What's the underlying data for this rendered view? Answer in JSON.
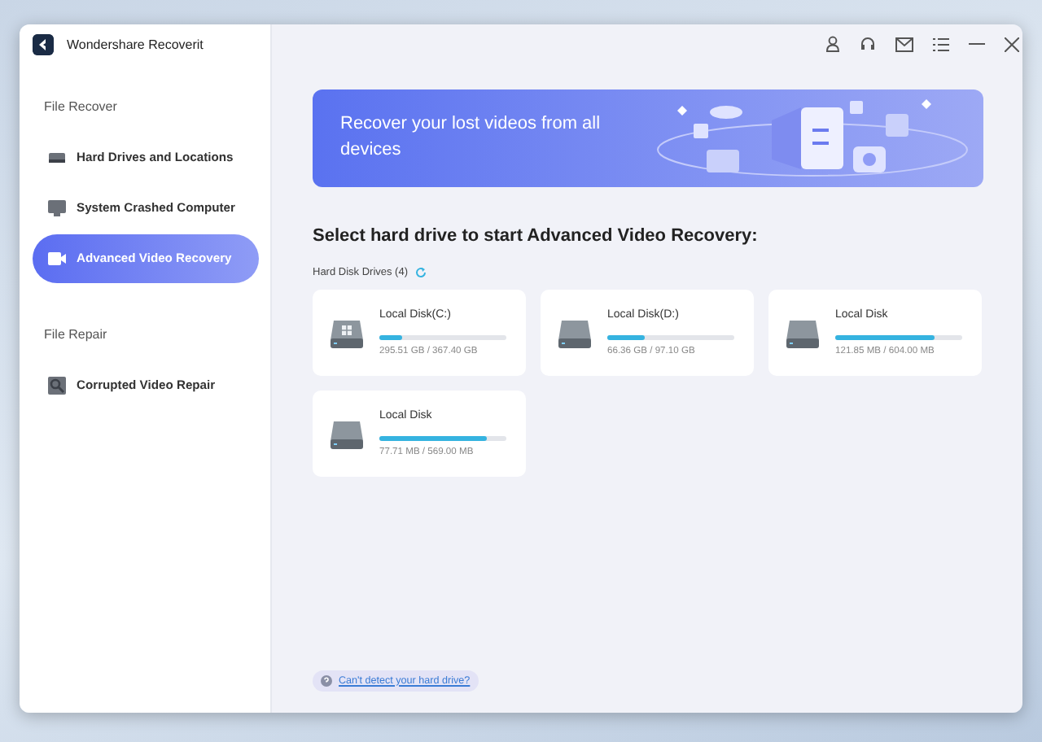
{
  "window": {
    "title": "Wondershare Recoverit"
  },
  "sidebar": {
    "sections": [
      {
        "heading": "File Recover",
        "items": [
          {
            "label": "Hard Drives and Locations",
            "kind": "drive",
            "selected": false
          },
          {
            "label": "System Crashed Computer",
            "kind": "monitor",
            "selected": false
          },
          {
            "label": "Advanced Video Recovery",
            "kind": "video",
            "selected": true
          }
        ]
      },
      {
        "heading": "File Repair",
        "items": [
          {
            "label": "Corrupted Video Repair",
            "kind": "repair",
            "selected": false
          }
        ]
      }
    ]
  },
  "banner": {
    "text": "Recover your lost videos from all devices"
  },
  "main": {
    "heading": "Select hard drive to start Advanced Video Recovery:",
    "subheading": "Hard Disk Drives (4)"
  },
  "drives": [
    {
      "name": "Local Disk(C:)",
      "kind": "system",
      "level": 0.18,
      "usage": "295.51 GB / 367.40 GB"
    },
    {
      "name": "Local Disk(D:)",
      "kind": "plain",
      "level": 0.3,
      "usage": "66.36 GB / 97.10 GB"
    },
    {
      "name": "Local Disk",
      "kind": "plain",
      "level": 0.78,
      "usage": "121.85 MB / 604.00 MB"
    },
    {
      "name": "Local Disk",
      "kind": "plain",
      "level": 0.85,
      "usage": "77.71 MB / 569.00 MB"
    }
  ],
  "help_link": {
    "text": "Can't detect your hard drive?"
  }
}
